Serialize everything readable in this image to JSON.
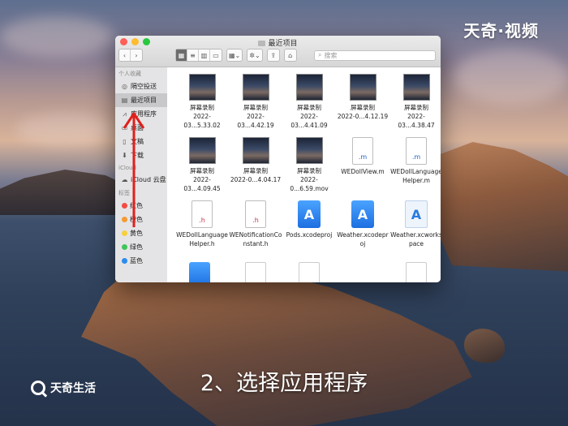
{
  "watermark": {
    "brand_top": "天奇·视频",
    "brand_bottom": "天奇生活"
  },
  "caption": "2、选择应用程序",
  "window": {
    "title": "最近项目",
    "search_placeholder": "搜索",
    "traffic_lights": [
      "#fe5f57",
      "#febc2e",
      "#28c840"
    ]
  },
  "sidebar": {
    "favorites_header": "个人收藏",
    "favorites": [
      {
        "label": "隔空投送",
        "icon": "airdrop-icon"
      },
      {
        "label": "最近项目",
        "icon": "clock-icon",
        "selected": true
      },
      {
        "label": "应用程序",
        "icon": "apps-icon"
      },
      {
        "label": "桌面",
        "icon": "desktop-icon"
      },
      {
        "label": "文稿",
        "icon": "doc-icon"
      },
      {
        "label": "下载",
        "icon": "download-icon"
      }
    ],
    "icloud_header": "iCloud",
    "icloud": [
      {
        "label": "iCloud 云盘",
        "icon": "cloud-icon"
      }
    ],
    "tags_header": "标签",
    "tags": [
      {
        "label": "红色",
        "color": "#f44b42"
      },
      {
        "label": "橙色",
        "color": "#f79a31"
      },
      {
        "label": "黄色",
        "color": "#f6d03e"
      },
      {
        "label": "绿色",
        "color": "#3fc45a"
      },
      {
        "label": "蓝色",
        "color": "#2b8cf0"
      }
    ]
  },
  "files": [
    {
      "type": "video",
      "line1": "屏幕录制",
      "line2": "2022-03...5.33.02"
    },
    {
      "type": "video",
      "line1": "屏幕录制",
      "line2": "2022-03...4.42.19"
    },
    {
      "type": "video",
      "line1": "屏幕录制",
      "line2": "2022-03...4.41.09"
    },
    {
      "type": "video",
      "line1": "屏幕录制",
      "line2": "2022-0...4.12.19"
    },
    {
      "type": "video",
      "line1": "屏幕录制",
      "line2": "2022-03...4.38.47"
    },
    {
      "type": "video",
      "line1": "屏幕录制",
      "line2": "2022-03...4.09.45"
    },
    {
      "type": "video",
      "line1": "屏幕录制",
      "line2": "2022-0...4.04.17"
    },
    {
      "type": "video",
      "line1": "屏幕录制",
      "line2": "2022-0...6.59.mov"
    },
    {
      "type": "m",
      "ext": ".m",
      "line1": "WEDollView.m",
      "line2": ""
    },
    {
      "type": "m",
      "ext": ".m",
      "line1": "WEDollLanguage",
      "line2": "Helper.m"
    },
    {
      "type": "h",
      "ext": ".h",
      "line1": "WEDollLanguage",
      "line2": "Helper.h"
    },
    {
      "type": "h",
      "ext": ".h",
      "line1": "WENotificationCo",
      "line2": "nstant.h"
    },
    {
      "type": "xcode",
      "line1": "Pods.xcodeproj",
      "line2": ""
    },
    {
      "type": "xcode",
      "line1": "Weather.xcodepr",
      "line2": "oj"
    },
    {
      "type": "ws",
      "line1": "Weather.xcworks",
      "line2": "pace"
    }
  ]
}
